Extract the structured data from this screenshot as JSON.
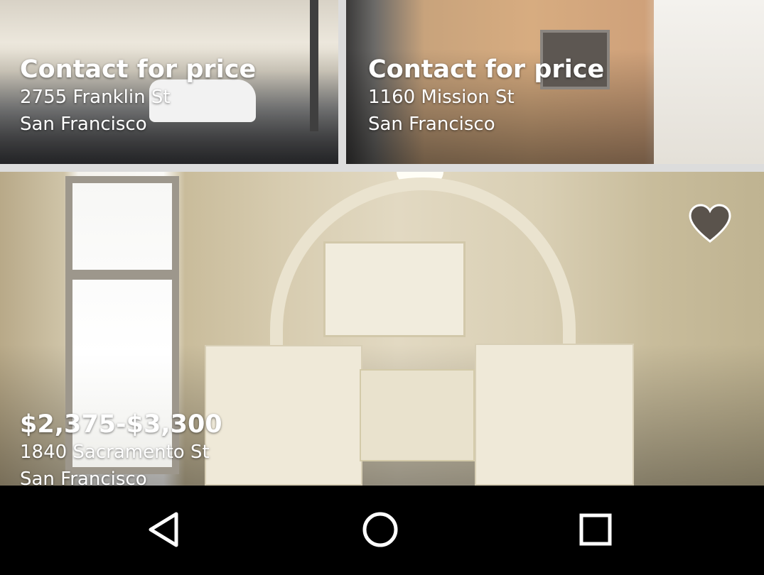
{
  "listings": [
    {
      "price": "Contact for price",
      "address": "2755 Franklin St",
      "city": "San Francisco"
    },
    {
      "price": "Contact for price",
      "address": "1160 Mission St",
      "city": "San Francisco"
    },
    {
      "price": "$2,375-$3,300",
      "address": "1840 Sacramento St",
      "city": "San Francisco",
      "favorite_icon": "heart-icon"
    }
  ],
  "nav_bar": {
    "back_icon": "back-triangle-icon",
    "home_icon": "home-circle-icon",
    "recents_icon": "recents-square-icon"
  },
  "colors": {
    "nav_background": "#000000",
    "overlay_text": "#ffffff",
    "heart_fill": "#5a534c",
    "divider": "#dcdcdc"
  }
}
